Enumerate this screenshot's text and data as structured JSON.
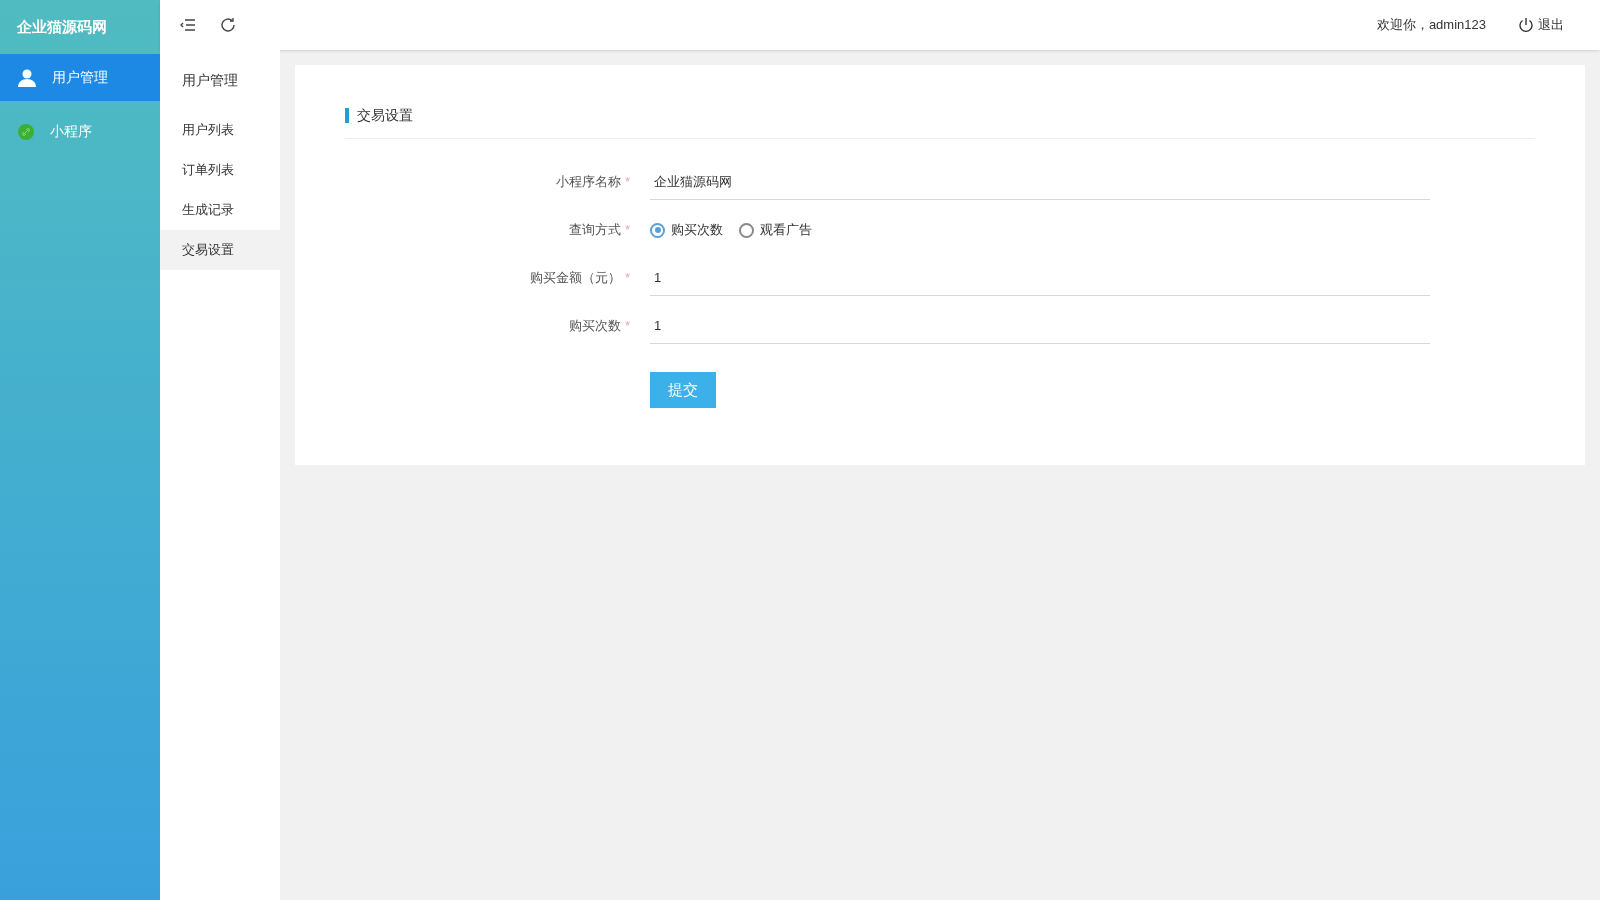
{
  "brand": "企业猫源码网",
  "sidebar": {
    "items": [
      {
        "label": "用户管理",
        "selected": true
      },
      {
        "label": "小程序",
        "selected": false
      }
    ]
  },
  "header": {
    "welcome": "欢迎你，admin123",
    "logout": "退出"
  },
  "submenu": {
    "title": "用户管理",
    "items": [
      {
        "label": "用户列表",
        "selected": false
      },
      {
        "label": "订单列表",
        "selected": false
      },
      {
        "label": "生成记录",
        "selected": false
      },
      {
        "label": "交易设置",
        "selected": true
      }
    ]
  },
  "card": {
    "title": "交易设置",
    "fields": [
      {
        "kind": "text",
        "label": "小程序名称",
        "required_mark": "*",
        "value": "企业猫源码网"
      },
      {
        "kind": "radio",
        "label": "查询方式",
        "required_mark": "*",
        "options": [
          {
            "label": "购买次数",
            "selected": true
          },
          {
            "label": "观看广告",
            "selected": false
          }
        ]
      },
      {
        "kind": "text",
        "label": "购买金额（元）",
        "required_mark": "*",
        "value": "1"
      },
      {
        "kind": "text",
        "label": "购买次数",
        "required_mark": "*",
        "value": "1"
      }
    ],
    "submit": "提交"
  }
}
